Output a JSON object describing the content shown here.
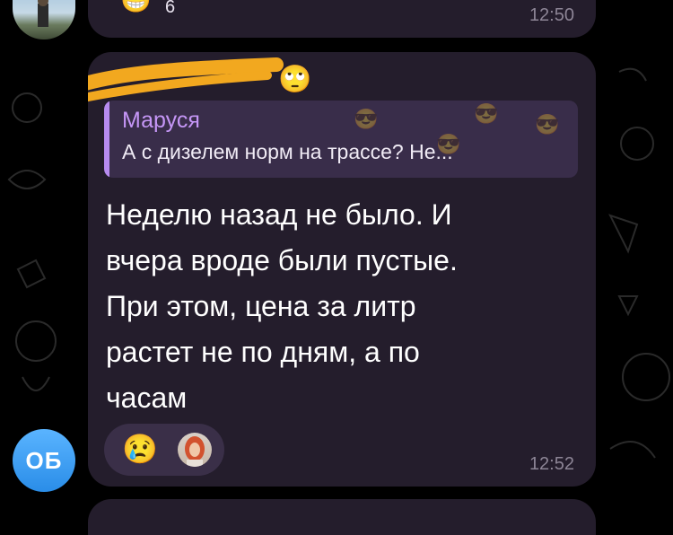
{
  "top_message": {
    "reaction_emoji": "😁",
    "reaction_count": "6",
    "time": "12:50"
  },
  "message": {
    "sender_emoji": "🙄",
    "reply": {
      "name": "Маруся",
      "text": "А с дизелем норм на трассе? Не..."
    },
    "lines": [
      "Неделю назад не было. И",
      "вчера вроде были пустые.",
      "При этом, цена за литр",
      "растет не по дням, а по",
      "часам"
    ],
    "reaction_emoji": "😢",
    "time": "12:52"
  },
  "sender_avatar": {
    "initials": "ОБ",
    "color": "#3d9cf5"
  },
  "colors": {
    "background": "#000000",
    "bubble": "#241d2c",
    "reply_accent": "#b78bf0",
    "scribble": "#f2a81f"
  }
}
